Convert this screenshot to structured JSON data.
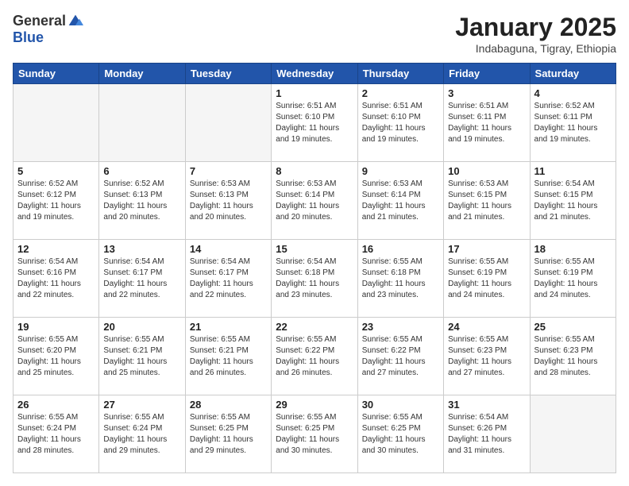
{
  "logo": {
    "general": "General",
    "blue": "Blue"
  },
  "header": {
    "month": "January 2025",
    "location": "Indabaguna, Tigray, Ethiopia"
  },
  "days_of_week": [
    "Sunday",
    "Monday",
    "Tuesday",
    "Wednesday",
    "Thursday",
    "Friday",
    "Saturday"
  ],
  "weeks": [
    [
      {
        "day": "",
        "info": ""
      },
      {
        "day": "",
        "info": ""
      },
      {
        "day": "",
        "info": ""
      },
      {
        "day": "1",
        "info": "Sunrise: 6:51 AM\nSunset: 6:10 PM\nDaylight: 11 hours and 19 minutes."
      },
      {
        "day": "2",
        "info": "Sunrise: 6:51 AM\nSunset: 6:10 PM\nDaylight: 11 hours and 19 minutes."
      },
      {
        "day": "3",
        "info": "Sunrise: 6:51 AM\nSunset: 6:11 PM\nDaylight: 11 hours and 19 minutes."
      },
      {
        "day": "4",
        "info": "Sunrise: 6:52 AM\nSunset: 6:11 PM\nDaylight: 11 hours and 19 minutes."
      }
    ],
    [
      {
        "day": "5",
        "info": "Sunrise: 6:52 AM\nSunset: 6:12 PM\nDaylight: 11 hours and 19 minutes."
      },
      {
        "day": "6",
        "info": "Sunrise: 6:52 AM\nSunset: 6:13 PM\nDaylight: 11 hours and 20 minutes."
      },
      {
        "day": "7",
        "info": "Sunrise: 6:53 AM\nSunset: 6:13 PM\nDaylight: 11 hours and 20 minutes."
      },
      {
        "day": "8",
        "info": "Sunrise: 6:53 AM\nSunset: 6:14 PM\nDaylight: 11 hours and 20 minutes."
      },
      {
        "day": "9",
        "info": "Sunrise: 6:53 AM\nSunset: 6:14 PM\nDaylight: 11 hours and 21 minutes."
      },
      {
        "day": "10",
        "info": "Sunrise: 6:53 AM\nSunset: 6:15 PM\nDaylight: 11 hours and 21 minutes."
      },
      {
        "day": "11",
        "info": "Sunrise: 6:54 AM\nSunset: 6:15 PM\nDaylight: 11 hours and 21 minutes."
      }
    ],
    [
      {
        "day": "12",
        "info": "Sunrise: 6:54 AM\nSunset: 6:16 PM\nDaylight: 11 hours and 22 minutes."
      },
      {
        "day": "13",
        "info": "Sunrise: 6:54 AM\nSunset: 6:17 PM\nDaylight: 11 hours and 22 minutes."
      },
      {
        "day": "14",
        "info": "Sunrise: 6:54 AM\nSunset: 6:17 PM\nDaylight: 11 hours and 22 minutes."
      },
      {
        "day": "15",
        "info": "Sunrise: 6:54 AM\nSunset: 6:18 PM\nDaylight: 11 hours and 23 minutes."
      },
      {
        "day": "16",
        "info": "Sunrise: 6:55 AM\nSunset: 6:18 PM\nDaylight: 11 hours and 23 minutes."
      },
      {
        "day": "17",
        "info": "Sunrise: 6:55 AM\nSunset: 6:19 PM\nDaylight: 11 hours and 24 minutes."
      },
      {
        "day": "18",
        "info": "Sunrise: 6:55 AM\nSunset: 6:19 PM\nDaylight: 11 hours and 24 minutes."
      }
    ],
    [
      {
        "day": "19",
        "info": "Sunrise: 6:55 AM\nSunset: 6:20 PM\nDaylight: 11 hours and 25 minutes."
      },
      {
        "day": "20",
        "info": "Sunrise: 6:55 AM\nSunset: 6:21 PM\nDaylight: 11 hours and 25 minutes."
      },
      {
        "day": "21",
        "info": "Sunrise: 6:55 AM\nSunset: 6:21 PM\nDaylight: 11 hours and 26 minutes."
      },
      {
        "day": "22",
        "info": "Sunrise: 6:55 AM\nSunset: 6:22 PM\nDaylight: 11 hours and 26 minutes."
      },
      {
        "day": "23",
        "info": "Sunrise: 6:55 AM\nSunset: 6:22 PM\nDaylight: 11 hours and 27 minutes."
      },
      {
        "day": "24",
        "info": "Sunrise: 6:55 AM\nSunset: 6:23 PM\nDaylight: 11 hours and 27 minutes."
      },
      {
        "day": "25",
        "info": "Sunrise: 6:55 AM\nSunset: 6:23 PM\nDaylight: 11 hours and 28 minutes."
      }
    ],
    [
      {
        "day": "26",
        "info": "Sunrise: 6:55 AM\nSunset: 6:24 PM\nDaylight: 11 hours and 28 minutes."
      },
      {
        "day": "27",
        "info": "Sunrise: 6:55 AM\nSunset: 6:24 PM\nDaylight: 11 hours and 29 minutes."
      },
      {
        "day": "28",
        "info": "Sunrise: 6:55 AM\nSunset: 6:25 PM\nDaylight: 11 hours and 29 minutes."
      },
      {
        "day": "29",
        "info": "Sunrise: 6:55 AM\nSunset: 6:25 PM\nDaylight: 11 hours and 30 minutes."
      },
      {
        "day": "30",
        "info": "Sunrise: 6:55 AM\nSunset: 6:25 PM\nDaylight: 11 hours and 30 minutes."
      },
      {
        "day": "31",
        "info": "Sunrise: 6:54 AM\nSunset: 6:26 PM\nDaylight: 11 hours and 31 minutes."
      },
      {
        "day": "",
        "info": ""
      }
    ]
  ]
}
